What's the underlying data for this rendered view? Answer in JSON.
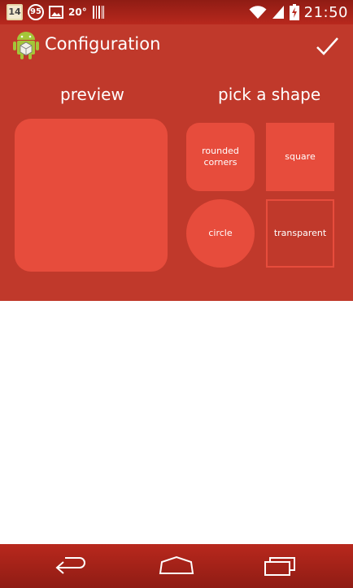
{
  "statusbar": {
    "calendar_day": "14",
    "badge_count": "95",
    "temperature": "20°",
    "time": "21:50",
    "icons": [
      "calendar-icon",
      "notification-count-icon",
      "gallery-icon",
      "temperature-icon",
      "barcode-icon",
      "wifi-icon",
      "signal-icon",
      "battery-charging-icon"
    ]
  },
  "actionbar": {
    "title": "Configuration",
    "app_icon": "android-icon",
    "confirm_icon": "check-icon"
  },
  "main": {
    "preview_heading": "preview",
    "pick_heading": "pick a shape",
    "shapes": [
      {
        "label": "rounded corners",
        "name": "rounded"
      },
      {
        "label": "square",
        "name": "square"
      },
      {
        "label": "circle",
        "name": "circle"
      },
      {
        "label": "transparent",
        "name": "transparent"
      }
    ],
    "selected_shape": "transparent"
  },
  "colors": {
    "accent": "#c0392b",
    "shape_fill": "#e74c3c",
    "statusbar": "#9e1f16"
  },
  "navbar": {
    "icons": [
      "back-icon",
      "home-icon",
      "recent-apps-icon"
    ]
  }
}
